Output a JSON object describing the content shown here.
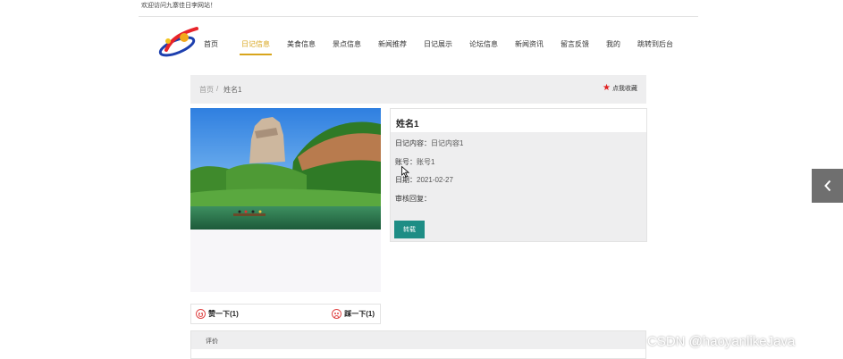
{
  "topbar": {
    "welcome": "欢迎访问九寨佳日李网站！"
  },
  "nav": {
    "items": [
      {
        "label": "首页",
        "active": false
      },
      {
        "label": "日记信息",
        "active": true
      },
      {
        "label": "美食信息",
        "active": false
      },
      {
        "label": "景点信息",
        "active": false
      },
      {
        "label": "新闻推荐",
        "active": false
      },
      {
        "label": "日记展示",
        "active": false
      },
      {
        "label": "论坛信息",
        "active": false
      },
      {
        "label": "新闻资讯",
        "active": false
      },
      {
        "label": "留言反馈",
        "active": false
      },
      {
        "label": "我的",
        "active": false
      },
      {
        "label": "跳转到后台",
        "active": false
      }
    ]
  },
  "breadcrumb": {
    "home": "首页",
    "separator": "/",
    "current": "姓名1"
  },
  "favorite": {
    "label": "点我收藏",
    "icon": "star-icon",
    "color": "#e02020"
  },
  "detail": {
    "title": "姓名1",
    "content_label": "日记内容：",
    "content_value": "日记内容1",
    "account_label": "账号：",
    "account_value": "账号1",
    "date_label": "日期：",
    "date_value": "2021-02-27",
    "reply_label": "审核回复：",
    "reply_value": "",
    "repost_button": "转载"
  },
  "votes": {
    "like_label": "赞一下(1)",
    "dislike_label": "踩一下(1)"
  },
  "review": {
    "header": "评价"
  },
  "watermark": "CSDN @haoyanlikeJava",
  "colors": {
    "accent": "#d8a51b",
    "button": "#1e8d85",
    "panel": "#eeeeef",
    "side_toggle": "#6f6f6f"
  }
}
